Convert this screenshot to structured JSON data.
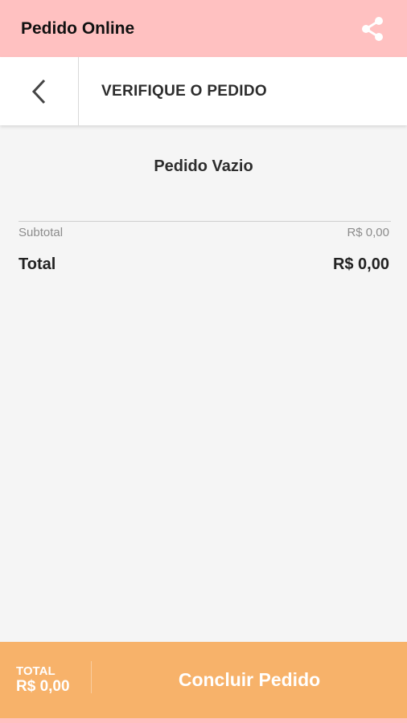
{
  "appbar": {
    "title": "Pedido Online",
    "share_icon": "share-icon",
    "color": "#ffc1c1"
  },
  "subheader": {
    "back_icon": "chevron-left-icon",
    "title": "VERIFIQUE O PEDIDO"
  },
  "order": {
    "empty_message": "Pedido Vazio",
    "subtotal_label": "Subtotal",
    "subtotal_value": "R$ 0,00",
    "total_label": "Total",
    "total_value": "R$ 0,00"
  },
  "footer": {
    "total_label": "TOTAL",
    "total_value": "R$ 0,00",
    "button_label": "Concluir Pedido",
    "color": "#f7b26a"
  }
}
